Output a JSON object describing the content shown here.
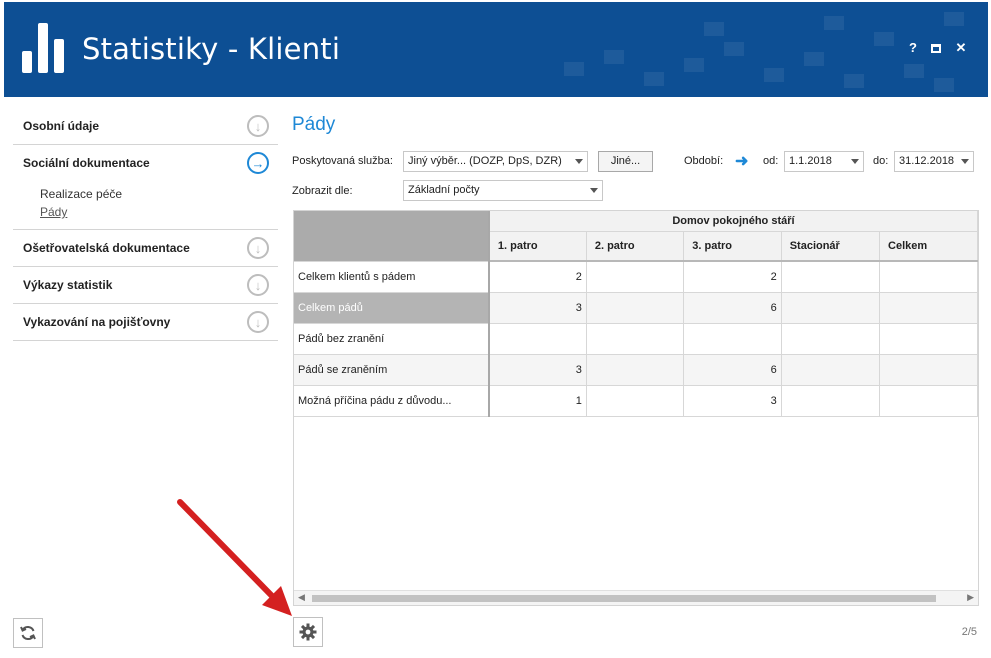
{
  "header": {
    "title": "Statistiky - Klienti",
    "help_label": "?",
    "maximize_icon": "maximize-icon",
    "close_label": "✕"
  },
  "sidebar": {
    "items": [
      {
        "label": "Osobní údaje",
        "icon": "arrow-down-circle-icon"
      },
      {
        "label": "Sociální dokumentace",
        "icon": "arrow-right-circle-icon",
        "active": true,
        "children": [
          {
            "label": "Realizace péče"
          },
          {
            "label": "Pády",
            "selected": true
          }
        ]
      },
      {
        "label": "Ošetřovatelská dokumentace",
        "icon": "arrow-down-circle-icon"
      },
      {
        "label": "Výkazy statistik",
        "icon": "arrow-down-circle-icon"
      },
      {
        "label": "Vykazování na pojišťovny",
        "icon": "arrow-down-circle-icon"
      }
    ]
  },
  "main": {
    "title": "Pády",
    "service_label": "Poskytovaná služba:",
    "service_value": "Jiný výběr... (DOZP, DpS, DZR)",
    "other_button": "Jiné...",
    "period_label": "Období:",
    "from_label": "od:",
    "from_value": "1.1.2018",
    "to_label": "do:",
    "to_value": "31.12.2018",
    "display_label": "Zobrazit dle:",
    "display_value": "Základní počty"
  },
  "table": {
    "group_header": "Domov pokojného stáří",
    "columns": [
      "1. patro",
      "2. patro",
      "3. patro",
      "Stacionář",
      "Celkem"
    ],
    "rows": [
      {
        "label": "Celkem klientů s pádem",
        "values": [
          "2",
          "",
          "2",
          "",
          ""
        ]
      },
      {
        "label": "Celkem pádů",
        "values": [
          "3",
          "",
          "6",
          "",
          ""
        ],
        "selected": true
      },
      {
        "label": "Pádů bez zranění",
        "values": [
          "",
          "",
          "",
          "",
          ""
        ]
      },
      {
        "label": "Pádů se zraněním",
        "values": [
          "3",
          "",
          "6",
          "",
          ""
        ]
      },
      {
        "label": "Možná příčina pádu z důvodu...",
        "values": [
          "1",
          "",
          "3",
          "",
          ""
        ]
      }
    ]
  },
  "footer": {
    "pager": "2/5",
    "refresh_icon": "refresh-icon",
    "settings_icon": "gear-icon"
  },
  "colors": {
    "header_bg": "#0d4f94",
    "accent": "#1e88d6",
    "annotation": "#d42020"
  }
}
